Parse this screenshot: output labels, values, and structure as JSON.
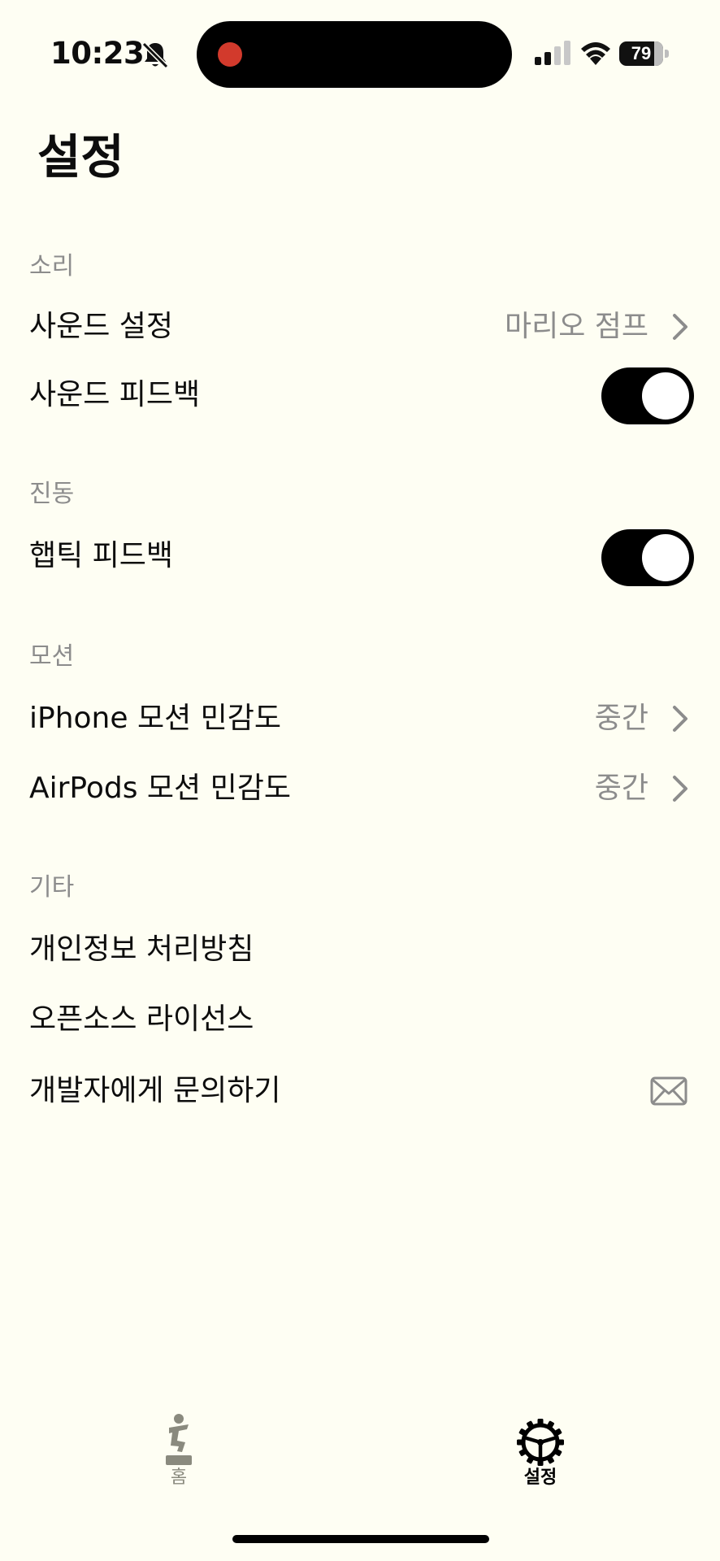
{
  "status_bar": {
    "time": "10:23",
    "battery": "79",
    "battery_level": 0.79
  },
  "page_title": "설정",
  "sections": {
    "sound": {
      "header": "소리",
      "sound_setting": {
        "label": "사운드 설정",
        "value": "마리오 점프"
      },
      "sound_feedback": {
        "label": "사운드 피드백",
        "on": true
      }
    },
    "vibration": {
      "header": "진동",
      "haptic_feedback": {
        "label": "햅틱 피드백",
        "on": true
      }
    },
    "motion": {
      "header": "모션",
      "iphone_sensitivity": {
        "label": "iPhone 모션 민감도",
        "value": "중간"
      },
      "airpods_sensitivity": {
        "label": "AirPods 모션 민감도",
        "value": "중간"
      }
    },
    "other": {
      "header": "기타",
      "privacy_policy": {
        "label": "개인정보 처리방침"
      },
      "open_source": {
        "label": "오픈소스 라이선스"
      },
      "contact_dev": {
        "label": "개발자에게 문의하기",
        "icon": "envelope-icon"
      }
    }
  },
  "tab_bar": {
    "home": {
      "label": "홈",
      "icon": "person-jump-icon",
      "color": "#8a8a7e"
    },
    "settings": {
      "label": "설정",
      "icon": "gear-icon",
      "color": "#000000",
      "selected": true
    }
  },
  "colors": {
    "background": "#fefef3",
    "secondary_text": "#8c8c8c",
    "toggle_on": "#000000",
    "recording_dot": "#d23a2c"
  }
}
